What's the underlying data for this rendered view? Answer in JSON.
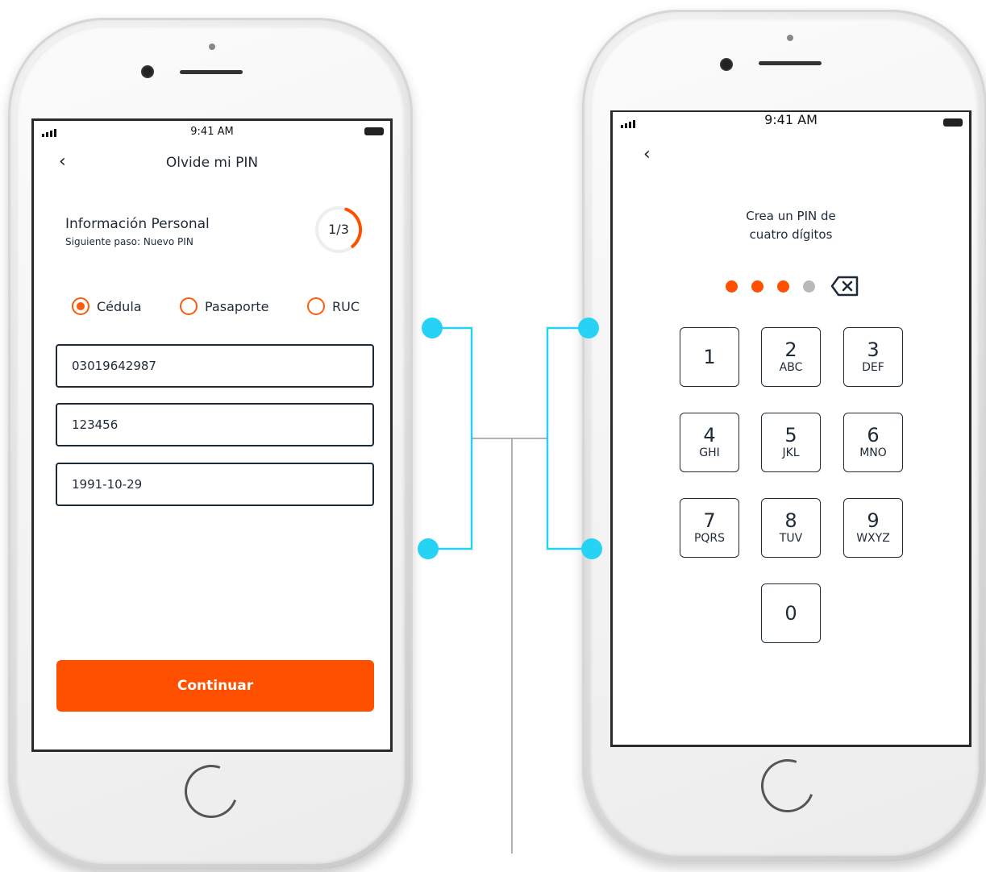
{
  "screen1": {
    "status_time": "9:41 AM",
    "back_icon": "chevron-left-icon",
    "title": "Olvide mi PIN",
    "section_title": "Información Personal",
    "section_subtitle": "Siguiente paso: Nuevo PIN",
    "progress_label": "1/3",
    "progress_fraction": 0.333,
    "doc_types": [
      {
        "label": "Cédula",
        "selected": true
      },
      {
        "label": "Pasaporte",
        "selected": false
      },
      {
        "label": "RUC",
        "selected": false
      }
    ],
    "fields": [
      "03019642987",
      "123456",
      "1991-10-29"
    ],
    "continue_label": "Continuar"
  },
  "screen2": {
    "status_time": "9:41 AM",
    "back_icon": "chevron-left-icon",
    "prompt_line1": "Crea un PIN de",
    "prompt_line2": "cuatro dígitos",
    "pin_filled": 3,
    "pin_length": 4,
    "delete_icon": "backspace-icon",
    "keys": [
      {
        "num": "1",
        "letters": ""
      },
      {
        "num": "2",
        "letters": "ABC"
      },
      {
        "num": "3",
        "letters": "DEF"
      },
      {
        "num": "4",
        "letters": "GHI"
      },
      {
        "num": "5",
        "letters": "JKL"
      },
      {
        "num": "6",
        "letters": "MNO"
      },
      {
        "num": "7",
        "letters": "PQRS"
      },
      {
        "num": "8",
        "letters": "TUV"
      },
      {
        "num": "9",
        "letters": "WXYZ"
      },
      {
        "num": "0",
        "letters": ""
      }
    ]
  },
  "colors": {
    "accent": "#ff5000",
    "pin_inactive": "#b9b9b9",
    "connector": "#27d3f5",
    "text": "#1f2a37"
  }
}
